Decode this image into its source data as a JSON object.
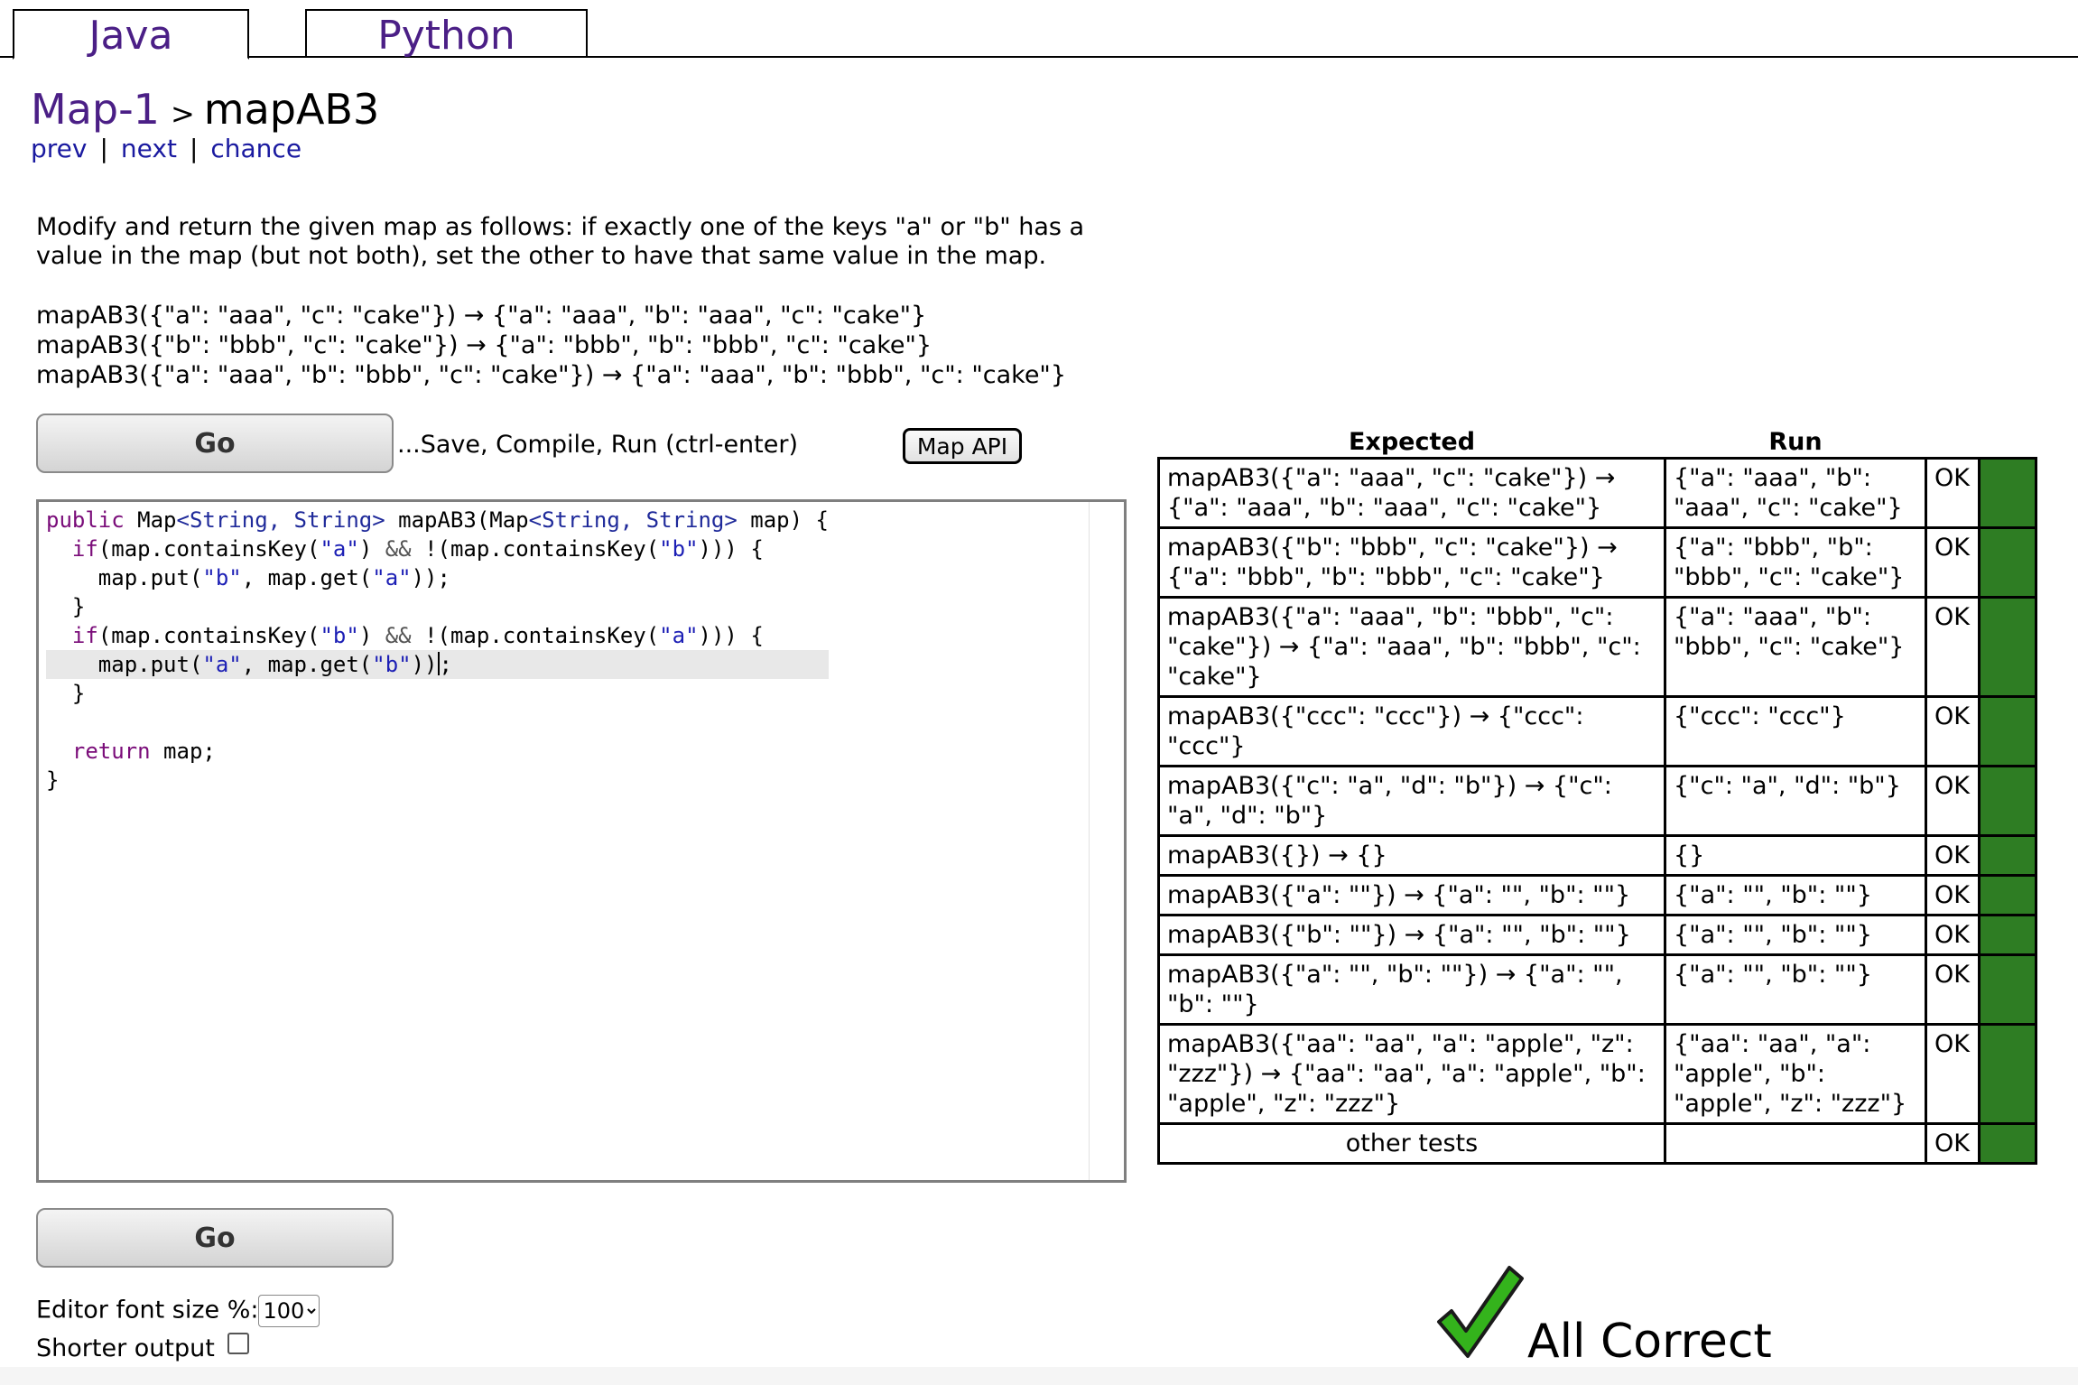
{
  "tabs": [
    {
      "label": "Java",
      "active": true
    },
    {
      "label": "Python",
      "active": false
    }
  ],
  "breadcrumb": {
    "category": "Map-1",
    "separator": ">",
    "problem": "mapAB3"
  },
  "nav": {
    "prev": "prev",
    "next": "next",
    "chance": "chance",
    "divider": "|"
  },
  "description": "Modify and return the given map as follows: if exactly one of the keys \"a\" or \"b\" has a value in the map (but not both), set the other to have that same value in the map.",
  "examples": [
    "mapAB3({\"a\": \"aaa\", \"c\": \"cake\"}) → {\"a\": \"aaa\", \"b\": \"aaa\", \"c\": \"cake\"}",
    "mapAB3({\"b\": \"bbb\", \"c\": \"cake\"}) → {\"a\": \"bbb\", \"b\": \"bbb\", \"c\": \"cake\"}",
    "mapAB3({\"a\": \"aaa\", \"b\": \"bbb\", \"c\": \"cake\"}) → {\"a\": \"aaa\", \"b\": \"bbb\", \"c\": \"cake\"}"
  ],
  "toolbar": {
    "go_label": "Go",
    "save_hint": "...Save, Compile, Run (ctrl-enter)",
    "map_api_label": "Map API"
  },
  "code_lines": [
    "public Map<String, String> mapAB3(Map<String, String> map) {",
    "  if(map.containsKey(\"a\") && !(map.containsKey(\"b\"))) {",
    "    map.put(\"b\", map.get(\"a\"));",
    "  }",
    "  if(map.containsKey(\"b\") && !(map.containsKey(\"a\"))) {",
    "    map.put(\"a\", map.get(\"b\"));",
    "  }",
    "",
    "  return map;",
    "}"
  ],
  "results": {
    "headers": {
      "expected": "Expected",
      "run": "Run"
    },
    "rows": [
      {
        "expected": "mapAB3({\"a\": \"aaa\", \"c\": \"cake\"}) → {\"a\": \"aaa\", \"b\": \"aaa\", \"c\": \"cake\"}",
        "run": "{\"a\": \"aaa\", \"b\": \"aaa\", \"c\": \"cake\"}",
        "status": "OK"
      },
      {
        "expected": "mapAB3({\"b\": \"bbb\", \"c\": \"cake\"}) → {\"a\": \"bbb\", \"b\": \"bbb\", \"c\": \"cake\"}",
        "run": "{\"a\": \"bbb\", \"b\": \"bbb\", \"c\": \"cake\"}",
        "status": "OK"
      },
      {
        "expected": "mapAB3({\"a\": \"aaa\", \"b\": \"bbb\", \"c\": \"cake\"}) → {\"a\": \"aaa\", \"b\": \"bbb\", \"c\": \"cake\"}",
        "run": "{\"a\": \"aaa\", \"b\": \"bbb\", \"c\": \"cake\"}",
        "status": "OK"
      },
      {
        "expected": "mapAB3({\"ccc\": \"ccc\"}) → {\"ccc\": \"ccc\"}",
        "run": "{\"ccc\": \"ccc\"}",
        "status": "OK"
      },
      {
        "expected": "mapAB3({\"c\": \"a\", \"d\": \"b\"}) → {\"c\": \"a\", \"d\": \"b\"}",
        "run": "{\"c\": \"a\", \"d\": \"b\"}",
        "status": "OK"
      },
      {
        "expected": "mapAB3({}) → {}",
        "run": "{}",
        "status": "OK"
      },
      {
        "expected": "mapAB3({\"a\": \"\"}) → {\"a\": \"\", \"b\": \"\"}",
        "run": "{\"a\": \"\", \"b\": \"\"}",
        "status": "OK"
      },
      {
        "expected": "mapAB3({\"b\": \"\"}) → {\"a\": \"\", \"b\": \"\"}",
        "run": "{\"a\": \"\", \"b\": \"\"}",
        "status": "OK"
      },
      {
        "expected": "mapAB3({\"a\": \"\", \"b\": \"\"}) → {\"a\": \"\", \"b\": \"\"}",
        "run": "{\"a\": \"\", \"b\": \"\"}",
        "status": "OK"
      },
      {
        "expected": "mapAB3({\"aa\": \"aa\", \"a\": \"apple\", \"z\": \"zzz\"}) → {\"aa\": \"aa\", \"a\": \"apple\", \"b\": \"apple\", \"z\": \"zzz\"}",
        "run": "{\"aa\": \"aa\", \"a\": \"apple\", \"b\": \"apple\", \"z\": \"zzz\"}",
        "status": "OK"
      }
    ],
    "other_tests": {
      "label": "other tests",
      "run": "",
      "status": "OK"
    },
    "pass_color": "#2e7d23"
  },
  "settings": {
    "font_size_label": "Editor font size %:",
    "font_size_value": "100",
    "shorter_output_label": "Shorter output",
    "shorter_output_checked": false
  },
  "verdict": {
    "icon": "check-icon",
    "label": "All Correct",
    "check_color": "#34b31c"
  }
}
